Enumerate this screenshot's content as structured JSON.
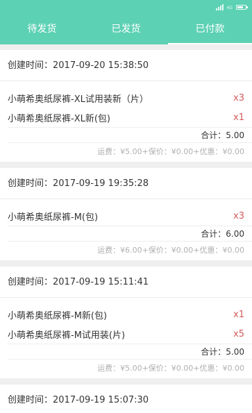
{
  "tabs": [
    {
      "label": "待发货",
      "active": false
    },
    {
      "label": "已发货",
      "active": false
    },
    {
      "label": "已付款",
      "active": true
    }
  ],
  "orders": [
    {
      "created": "创建时间：2017-09-20 15:38:50",
      "items": [
        {
          "name": "小萌希奥纸尿裤-XL试用装新（片）",
          "qty": "x3"
        },
        {
          "name": "小萌希奥纸尿裤-XL新(包)",
          "qty": "x1"
        }
      ],
      "total": "合计：5.00",
      "fees": "运费：¥5.00+保价：¥0.00+优惠：¥0.00"
    },
    {
      "created": "创建时间：2017-09-19 19:35:28",
      "items": [
        {
          "name": "小萌希奥纸尿裤-M(包)",
          "qty": "x3"
        }
      ],
      "total": "合计：6.00",
      "fees": "运费：¥6.00+保价：¥0.00+优惠：¥0.00"
    },
    {
      "created": "创建时间：2017-09-19 15:11:41",
      "items": [
        {
          "name": "小萌希奥纸尿裤-M新(包)",
          "qty": "x1"
        },
        {
          "name": "小萌希奥纸尿裤-M试用装(片)",
          "qty": "x5"
        }
      ],
      "total": "合计：5.00",
      "fees": "运费：¥5.00+保价：¥0.00+优惠：¥0.00"
    },
    {
      "created": "创建时间：2017-09-19 15:07:30"
    }
  ],
  "colors": {
    "header": "#5dd1b3",
    "quantity": "#d25a5a",
    "fee_text": "#b0b0b0",
    "background": "#efefef"
  },
  "icons": [
    "signal-icon",
    "battery-icon"
  ]
}
